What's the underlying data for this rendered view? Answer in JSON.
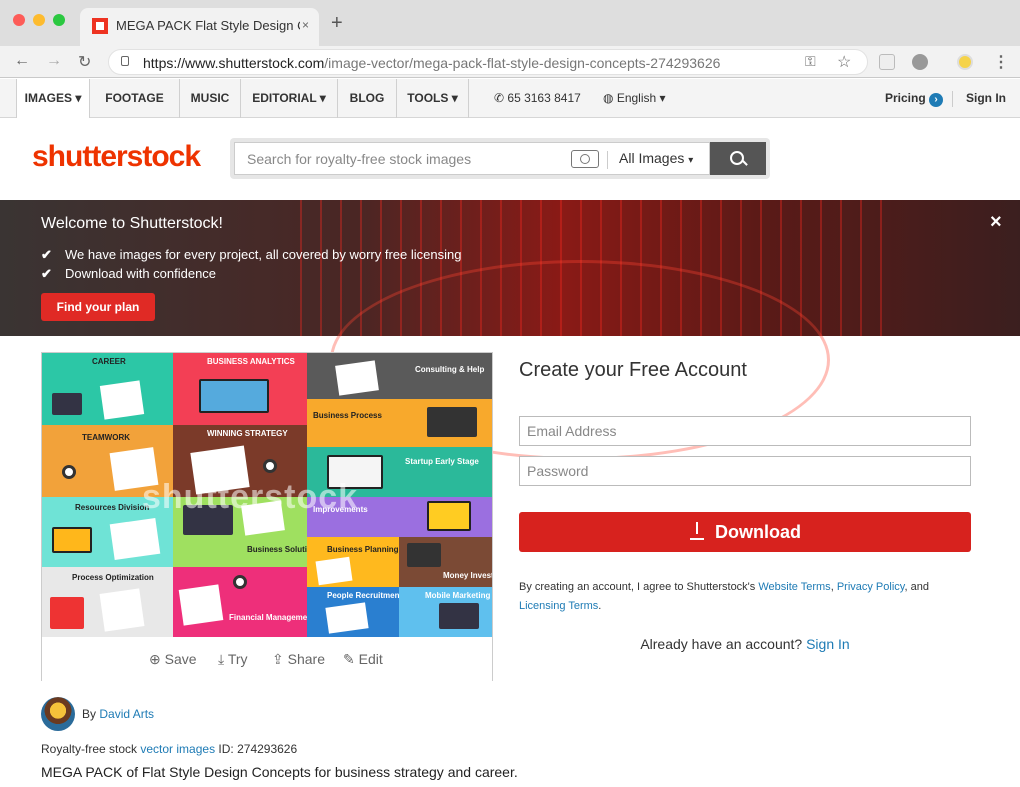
{
  "browser": {
    "tab_title": "MEGA PACK Flat Style Design C",
    "url_domain": "https://www.shutterstock.com",
    "url_path": "/image-vector/mega-pack-flat-style-design-concepts-274293626"
  },
  "nav": {
    "items": [
      "IMAGES ▾",
      "FOOTAGE",
      "MUSIC",
      "EDITORIAL ▾",
      "BLOG",
      "TOOLS ▾"
    ],
    "phone": "65 3163 8417",
    "language": "English ▾",
    "pricing": "Pricing",
    "sign_in": "Sign In"
  },
  "header": {
    "logo": "shutterstock",
    "search_placeholder": "Search for royalty-free stock images",
    "search_scope": "All Images"
  },
  "banner": {
    "title": "Welcome to Shutterstock!",
    "bullets": [
      "We have images for every project, all covered by worry free licensing",
      "Download with confidence"
    ],
    "cta": "Find your plan",
    "close": "×"
  },
  "image": {
    "watermark": "shutterstock",
    "tiles": [
      "CAREER",
      "BUSINESS ANALYTICS",
      "Consulting & Help",
      "Business Process",
      "TEAMWORK",
      "WINNING STRATEGY",
      "Startup Early Stage",
      "Resources Division",
      "Improvements",
      "Business Solution",
      "Business Planning",
      "Money Investments",
      "Process Optimization",
      "Financial Management",
      "People Recruitment",
      "Mobile Marketing"
    ],
    "actions": {
      "save": "Save",
      "try": "Try",
      "share": "Share",
      "edit": "Edit"
    }
  },
  "signup": {
    "title": "Create your Free Account",
    "email_placeholder": "Email Address",
    "password_placeholder": "Password",
    "download": "Download",
    "terms_prefix": "By creating an account, I agree to Shutterstock's ",
    "terms_link1": "Website Terms",
    "terms_sep": ", ",
    "terms_link2": "Privacy Policy",
    "terms_and": ", and",
    "terms_link3": "Licensing Terms",
    "terms_end": ".",
    "already": "Already have an account?",
    "signin": "Sign In"
  },
  "author": {
    "by": "By",
    "name": "David Arts",
    "rf_prefix": "Royalty-free stock",
    "rf_link": "vector images",
    "id_text": "ID: 274293626",
    "description": "MEGA PACK of Flat Style Design Concepts for business strategy and career."
  }
}
